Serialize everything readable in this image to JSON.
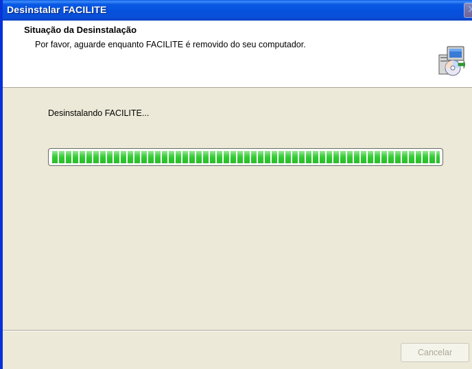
{
  "window": {
    "title": "Desinstalar FACILITE"
  },
  "header": {
    "title": "Situação da Desinstalação",
    "subtitle": "Por favor, aguarde enquanto FACILITE é removido do seu computador.",
    "icon": "installer-cd-icon"
  },
  "body": {
    "status_text": "Desinstalando FACILITE...",
    "progress_fraction": 1.0
  },
  "footer": {
    "cancel_label": "Cancelar",
    "cancel_enabled": false
  },
  "colors": {
    "titlebar": "#0550dc",
    "progress": "#2ecb2e",
    "background": "#ece9d8"
  }
}
